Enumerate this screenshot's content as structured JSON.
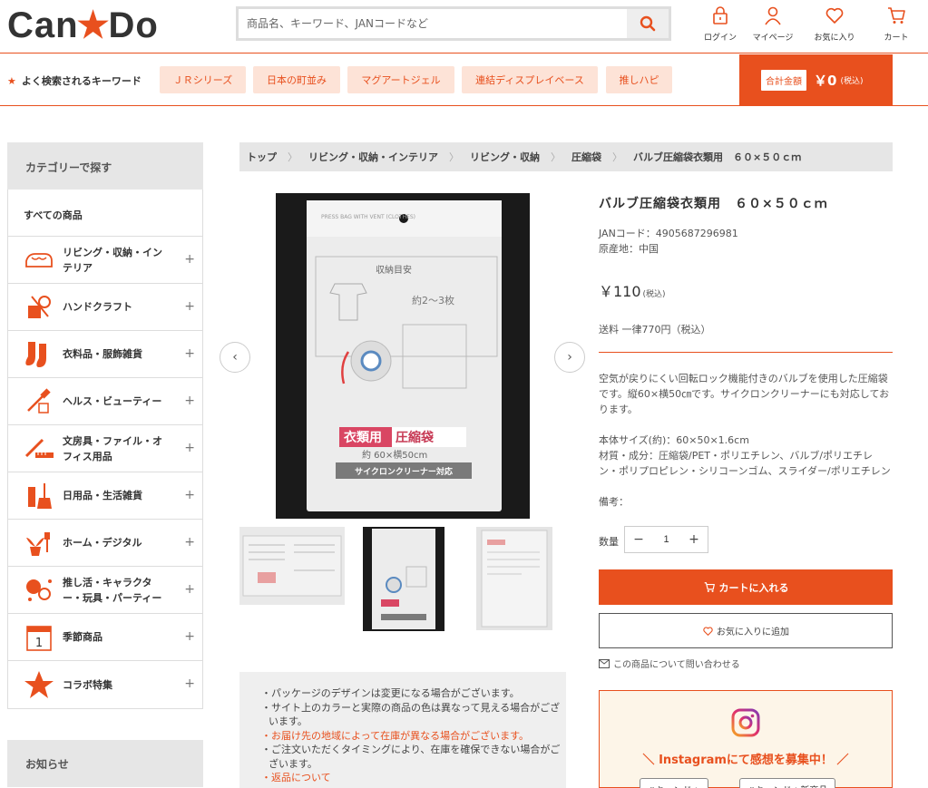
{
  "header": {
    "logo_left": "Can",
    "logo_right": "Do",
    "search_placeholder": "商品名、キーワード、JANコードなど",
    "icons": [
      {
        "label": "ログイン",
        "icon": "lock-icon"
      },
      {
        "label": "マイページ",
        "icon": "person-icon"
      },
      {
        "label": "お気に入り",
        "icon": "heart-icon"
      },
      {
        "label": "カート",
        "icon": "cart-icon"
      }
    ]
  },
  "keywords": {
    "title": "よく検索されるキーワード",
    "items": [
      "ＪＲシリーズ",
      "日本の町並み",
      "マグアートジェル",
      "連結ディスプレイベース",
      "推しハピ"
    ]
  },
  "cart_total": {
    "label": "合計金額",
    "value": "￥0",
    "tax": "(税込)"
  },
  "sidebar": {
    "heading": "カテゴリーで探す",
    "all_label": "すべての商品",
    "categories": [
      {
        "label": "リビング・収納・インテリア"
      },
      {
        "label": "ハンドクラフト"
      },
      {
        "label": "衣料品・服飾雑貨"
      },
      {
        "label": "ヘルス・ビューティー"
      },
      {
        "label": "文房具・ファイル・オフィス用品"
      },
      {
        "label": "日用品・生活雑貨"
      },
      {
        "label": "ホーム・デジタル"
      },
      {
        "label": "推し活・キャラクター・玩具・パーティー"
      },
      {
        "label": "季節商品"
      },
      {
        "label": "コラボ特集"
      }
    ],
    "news_heading": "お知らせ"
  },
  "breadcrumb": [
    "トップ",
    "リビング・収納・インテリア",
    "リビング・収納",
    "圧縮袋",
    "バルブ圧縮袋衣類用　６０×５０ｃｍ"
  ],
  "product": {
    "title": "バルブ圧縮袋衣類用　６０×５０ｃｍ",
    "jan": "JANコード：4905687296981",
    "origin": "原産地：中国",
    "price": "￥110",
    "price_tax": "(税込)",
    "shipping": "送料 一律770円（税込）",
    "description": "空気が戻りにくい回転ロック機能付きのバルブを使用した圧縮袋です。縦60×横50㎝です。サイクロンクリーナーにも対応しております。",
    "size": "本体サイズ(約)：60×50×1.6cm",
    "material": "材質・成分：圧縮袋/PET・ポリエチレン、バルブ/ポリエチレン・ポリプロピレン・シリコーンゴム、スライダー/ポリエチレン",
    "remarks": "備考：",
    "qty_label": "数量",
    "qty_value": "1",
    "cart_button": "カートに入れる",
    "fav_button": "お気に入りに追加",
    "inquiry": "この商品について問い合わせる",
    "bag_texts": {
      "top": "PRESS BAG WITH VENT (CLOTHES)",
      "guide": "収納目安",
      "qty": "約2～3枚",
      "name_a": "衣類用",
      "name_b": "圧縮袋",
      "size": "約 60×横50cm",
      "cyclone": "サイクロンクリーナー対応"
    }
  },
  "notes": [
    {
      "text": "・パッケージのデザインは変更になる場合がございます。",
      "red": false
    },
    {
      "text": "・サイト上のカラーと実際の商品の色は異なって見える場合がございます。",
      "red": false
    },
    {
      "text": "・お届け先の地域によって在庫が異なる場合がございます。",
      "red": true
    },
    {
      "text": "・ご注文いただくタイミングにより、在庫を確保できない場合がございます。",
      "red": false
    },
    {
      "text": "・返品について",
      "red": true
    }
  ],
  "instagram": {
    "title": "＼ Instagramにて感想を募集中！ ／",
    "tags": [
      "#キャンドゥ",
      "#キャンドゥ新商品"
    ]
  },
  "colors": {
    "accent": "#e8501e",
    "tag_bg": "#fde3d7",
    "panel_gray": "#e6e6e6"
  }
}
